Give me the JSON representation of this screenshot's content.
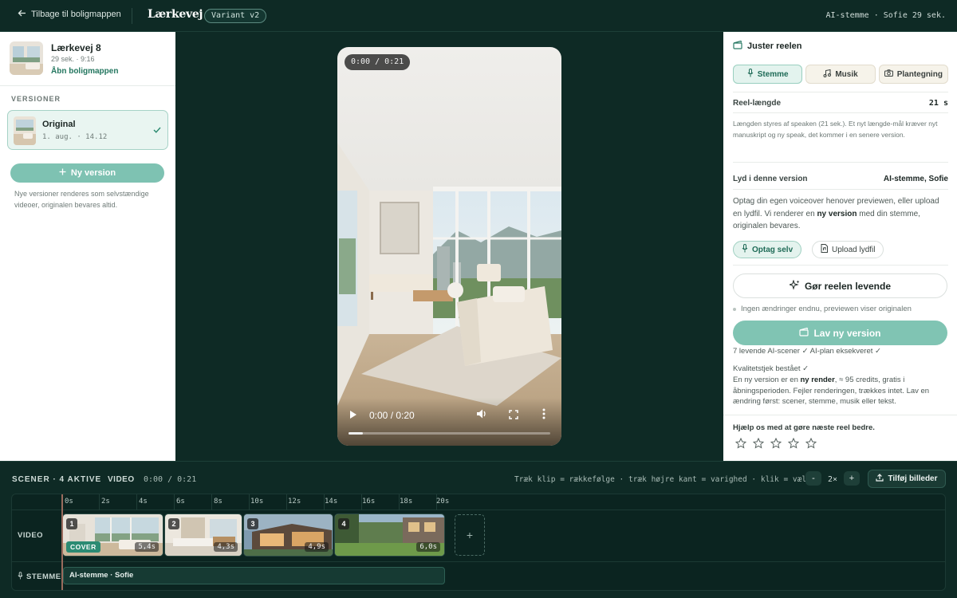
{
  "topbar": {
    "back_label": "Tilbage til boligmappen",
    "property_title": "Lærkevej 8",
    "variant_badge": "Variant v2",
    "right_info": "AI-stemme · Sofie  29 sek."
  },
  "left_panel": {
    "property_name": "Lærkevej 8",
    "property_meta": "29 sek. · 9:16",
    "open_folder_link": "Åbn boligmappen",
    "versions_header": "VERSIONER",
    "versions": [
      {
        "name": "Original",
        "date": "1. aug. · 14.12",
        "selected": true
      }
    ],
    "new_version_label": "Ny version",
    "note": "Nye versioner renderes som selvstændige videoer, originalen bevares altid."
  },
  "preview": {
    "time_pill": "0:00 / 0:21",
    "player_time": "0:00 / 0:20",
    "progress": 0.07
  },
  "right_panel": {
    "title": "Juster reelen",
    "tabs": [
      {
        "label": "Stemme",
        "icon": "mic-icon",
        "active": true
      },
      {
        "label": "Musik",
        "icon": "music-icon",
        "active": false
      },
      {
        "label": "Plantegning",
        "icon": "camera-icon",
        "active": false
      }
    ],
    "length_label": "Reel-længde",
    "length_value": "21 s",
    "length_note": "Længden styres af speaken (21 sek.). Et nyt længde-mål kræver nyt manuskript og ny speak, det kommer i en senere version.",
    "audio_label": "Lyd i denne version",
    "audio_value": "AI-stemme, Sofie",
    "voice_text_1": "Optag din egen voiceover henover previewen, eller upload en lydfil. Vi renderer en ",
    "voice_text_bold": "ny version",
    "voice_text_2": " med din stemme, originalen bevares.",
    "record_label": "Optag selv",
    "upload_label": "Upload lydfil",
    "alive_label": "Gør reelen levende",
    "no_changes": "Ingen ændringer endnu, previewen viser originalen",
    "make_version_label": "Lav ny version",
    "checks_line": "7 levende AI-scener ✓   AI-plan eksekveret ✓",
    "quality_line": "Kvalitetstjek bestået ✓",
    "render_text_1": "En ny version er en ",
    "render_text_bold": "ny render",
    "render_text_2": ", ≈ 95 credits, gratis i åbningsperioden. Fejler renderingen, trækkes intet. Lav en ændring først: scener, stemme, musik eller tekst.",
    "feedback_label": "Hjælp os med at gøre næste reel bedre.",
    "rating": 0,
    "rating_max": 5
  },
  "timeline": {
    "title": "SCENER · 4 AKTIVE",
    "video_label": "VIDEO",
    "time": "0:00 / 0:21",
    "hint": "Træk klip = rækkefølge · træk højre kant = varighed · klik = vælg",
    "zoom_minus": "-",
    "zoom_value": "2×",
    "zoom_plus": "+",
    "add_images_label": "Tilføj billeder",
    "ticks": [
      "0s",
      "2s",
      "4s",
      "6s",
      "8s",
      "10s",
      "12s",
      "14s",
      "16s",
      "18s",
      "20s"
    ],
    "video_track_label": "VIDEO",
    "voice_track_label": "STEMME",
    "voice_clip_label": "AI-stemme · Sofie",
    "clips": [
      {
        "num": "1",
        "duration": "5,4s",
        "cover": "COVER"
      },
      {
        "num": "2",
        "duration": "4,3s"
      },
      {
        "num": "3",
        "duration": "4,9s"
      },
      {
        "num": "4",
        "duration": "6,0s"
      }
    ],
    "add_clip_label": "+"
  }
}
